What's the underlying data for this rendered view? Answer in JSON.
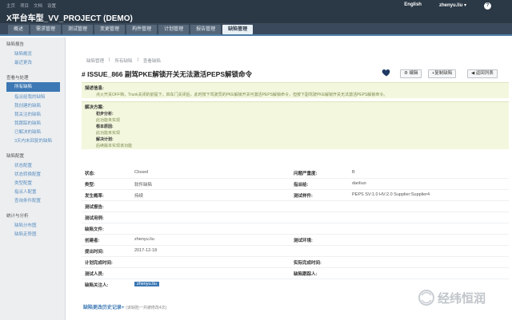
{
  "top": {
    "links": [
      "主页",
      "项目",
      "文档",
      "设置"
    ],
    "language": "English",
    "user": "zhenyu.liu",
    "help": "?"
  },
  "app": {
    "title": "X平台车型_VV_PROJECT (DEMO)"
  },
  "nav": {
    "tabs": [
      "概述",
      "需求管理",
      "测试管理",
      "变更管理",
      "构件管理",
      "计划管理",
      "报告管理",
      "缺陷管理"
    ],
    "active_index": 7
  },
  "sidebar": {
    "groups": [
      {
        "title": "缺陷报告",
        "items": [
          "缺陷概览",
          "最近更改"
        ]
      },
      {
        "title": "查看与处理",
        "items": [
          "所有缺陷",
          "指派给我的缺陷",
          "我创建的缺陷",
          "我关注的缺陷",
          "我跟踪的缺陷",
          "已解决的缺陷",
          "3天内未回复的缺陷"
        ]
      },
      {
        "title": "缺陷配置",
        "items": [
          "状态配置",
          "状态转换配置",
          "类型配置",
          "指派人配置",
          "查询条件配置"
        ]
      },
      {
        "title": "统计与分析",
        "items": [
          "缺陷分布图",
          "缺陷走势图"
        ]
      }
    ],
    "active_item": "所有缺陷"
  },
  "breadcrumb": [
    "缺陷管理",
    "所有缺陷",
    "查看缺陷"
  ],
  "issue": {
    "title": "# ISSUE_866   副驾PKE解锁开关无法激活PEPS解锁命令",
    "actions": [
      "⚙ 编辑",
      "+复制缺陷",
      "◀ 返回列表"
    ]
  },
  "description": {
    "label": "描述信息:",
    "text": "点火开关OFF档，Trunk关闭的前提下，四车门关闭后，此时按下驾驶员的PKE解锁开关可激活PEPS解锁命令，但按下副驾驶PKE解锁开关无法激活PEPS解锁命令。"
  },
  "solution": {
    "label": "解决方案:",
    "lines": [
      {
        "k": "初步分析:",
        "v": "此功能未实现"
      },
      {
        "k": "根本原因:",
        "v": "此功能未实现"
      },
      {
        "k": "解决计划:",
        "v": "后续版本实现该功能"
      }
    ]
  },
  "fields": {
    "status": {
      "label": "状态:",
      "value": "Closed"
    },
    "severity": {
      "label": "问题严重度:",
      "value": "B"
    },
    "type": {
      "label": "类型:",
      "value": "软件缺陷"
    },
    "assignee": {
      "label": "指派给:",
      "value": "danliuo"
    },
    "frequency": {
      "label": "发生概率:",
      "value": "持续"
    },
    "sample": {
      "label": "测试样件:",
      "value": "PEPS SV:1.0 HV:2.0 Supplier:Supplier4"
    },
    "report": {
      "label": "测试报告:",
      "value": ""
    },
    "case": {
      "label": "测试用例:",
      "value": ""
    },
    "attachment": {
      "label": "缺陷文件:",
      "value": ""
    },
    "creator": {
      "label": "创建者:",
      "value": "zhenyu.liu"
    },
    "env": {
      "label": "测试环境:",
      "value": ""
    },
    "date": {
      "label": "提出时间:",
      "value": "2017-12-18"
    },
    "plan_date": {
      "label": "计划完成时间:",
      "value": ""
    },
    "actual_date": {
      "label": "实际完成时间:",
      "value": ""
    },
    "tester": {
      "label": "测试人员:",
      "value": ""
    },
    "tracker": {
      "label": "缺陷跟踪人:",
      "value": ""
    },
    "watcher": {
      "label": "缺陷关注人:",
      "value": "zhenyu.liu"
    }
  },
  "history": {
    "link": "缺陷更改历史记录+",
    "note": "(该缺陷一共被修改4次)"
  },
  "watermark": "经纬恒润",
  "colors": {
    "topbar": "#2b3845",
    "accent": "#3c78b4",
    "desc_bg": "#f3f7dd",
    "heart": "#1f3b63"
  }
}
